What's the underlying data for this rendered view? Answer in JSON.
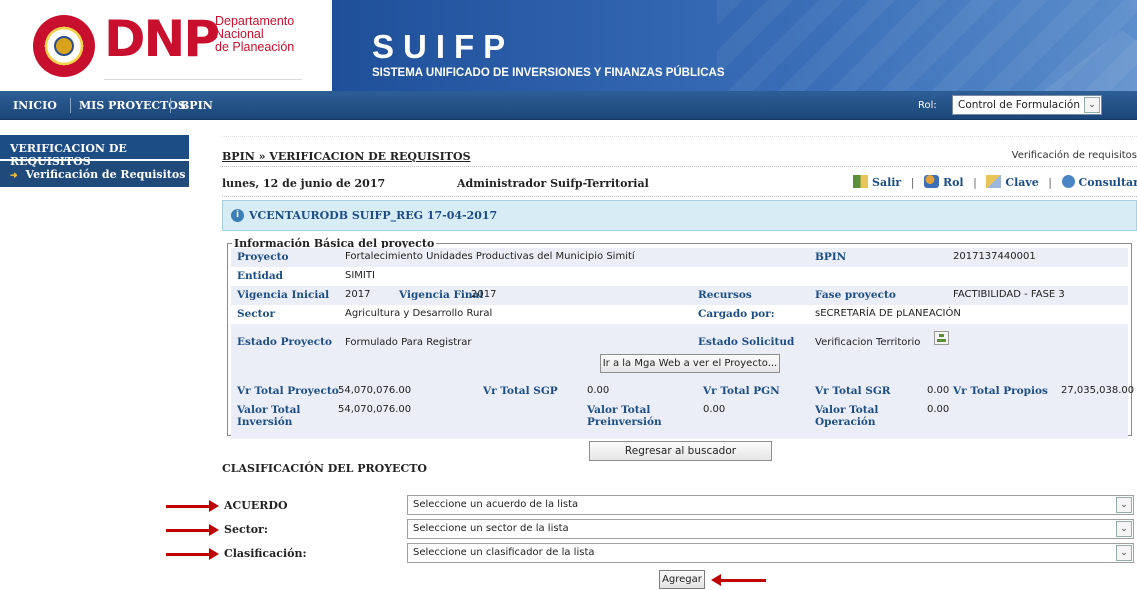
{
  "header": {
    "logo_text": "DNP",
    "logo_sub": [
      "Departamento",
      "Nacional",
      "de Planeación"
    ],
    "seal_text": "REPÚBLICA DE COLOMBIA",
    "app_title": "SUIFP",
    "app_subtitle": "SISTEMA UNIFICADO DE INVERSIONES Y FINANZAS PÚBLICAS"
  },
  "nav": {
    "items": [
      "INICIO",
      "MIS PROYECTOS",
      "BPIN"
    ],
    "rol_label": "Rol:",
    "rol_value": "Control de Formulación"
  },
  "sidebar": {
    "heading": "VERIFICACION DE REQUISITOS",
    "items": [
      {
        "label": "Verificación de Requisitos"
      }
    ]
  },
  "main": {
    "breadcrumb": "BPIN » VERIFICACION DE REQUISITOS",
    "page_right": "Verificación de requisitos",
    "date": "lunes, 12 de junio de 2017",
    "user": "Administrador Suifp-Territorial",
    "links": [
      "Salir",
      "Rol",
      "Clave",
      "Consultar Ayuda"
    ],
    "db_info": "VCENTAURODB SUIFP_REG 17-04-2017"
  },
  "project": {
    "legend": "Información Básica del proyecto",
    "labels": {
      "proyecto": "Proyecto",
      "bpin": "BPIN",
      "entidad": "Entidad",
      "vigencia_inicial": "Vigencia Inicial",
      "vigencia_final": "Vigencia Final",
      "recursos": "Recursos",
      "fase": "Fase proyecto",
      "sector": "Sector",
      "cargado": "Cargado por:",
      "estado_proyecto": "Estado Proyecto",
      "estado_solicitud": "Estado Solicitud",
      "vr_total_proyecto": "Vr Total Proyecto",
      "vr_total_sgp": "Vr Total SGP",
      "vr_total_pgn": "Vr Total PGN",
      "vr_total_sgr": "Vr Total SGR",
      "vr_total_propios": "Vr Total Propios",
      "valor_total_inversion": [
        "Valor Total",
        "Inversión"
      ],
      "valor_total_preinversion": [
        "Valor Total",
        "Preinversión"
      ],
      "valor_total_operacion": [
        "Valor Total",
        "Operación"
      ]
    },
    "values": {
      "proyecto": "Fortalecimiento Unidades Productivas del Municipio Simití",
      "bpin": "2017137440001",
      "entidad": "SIMITI",
      "vigencia_inicial": "2017",
      "vigencia_final": "2017",
      "fase": "FACTIBILIDAD - FASE 3",
      "sector": "Agricultura y Desarrollo Rural",
      "cargado": "sECRETARÍA DE pLANEACIÓN",
      "estado_proyecto": "Formulado Para Registrar",
      "estado_solicitud": "Verificacion Territorio",
      "vr_total_proyecto": "54,070,076.00",
      "vr_total_sgp": "0.00",
      "vr_total_sgr": "0.00",
      "vr_total_propios": "27,035,038.00",
      "valor_total_inversion": "54,070,076.00",
      "valor_total_preinversion": "0.00",
      "valor_total_operacion": "0.00"
    },
    "mga_button": "Ir a la Mga Web a ver el Proyecto..."
  },
  "regresar_button": "Regresar al buscador",
  "clasificacion": {
    "title": "CLASIFICACIÓN DEL PROYECTO",
    "fields": [
      {
        "label": "ACUERDO",
        "placeholder": "Seleccione un acuerdo de la lista"
      },
      {
        "label": "Sector:",
        "placeholder": "Seleccione un sector de la lista"
      },
      {
        "label": "Clasificación:",
        "placeholder": "Seleccione un clasificador de la lista"
      }
    ],
    "add_button": "Agregar"
  }
}
